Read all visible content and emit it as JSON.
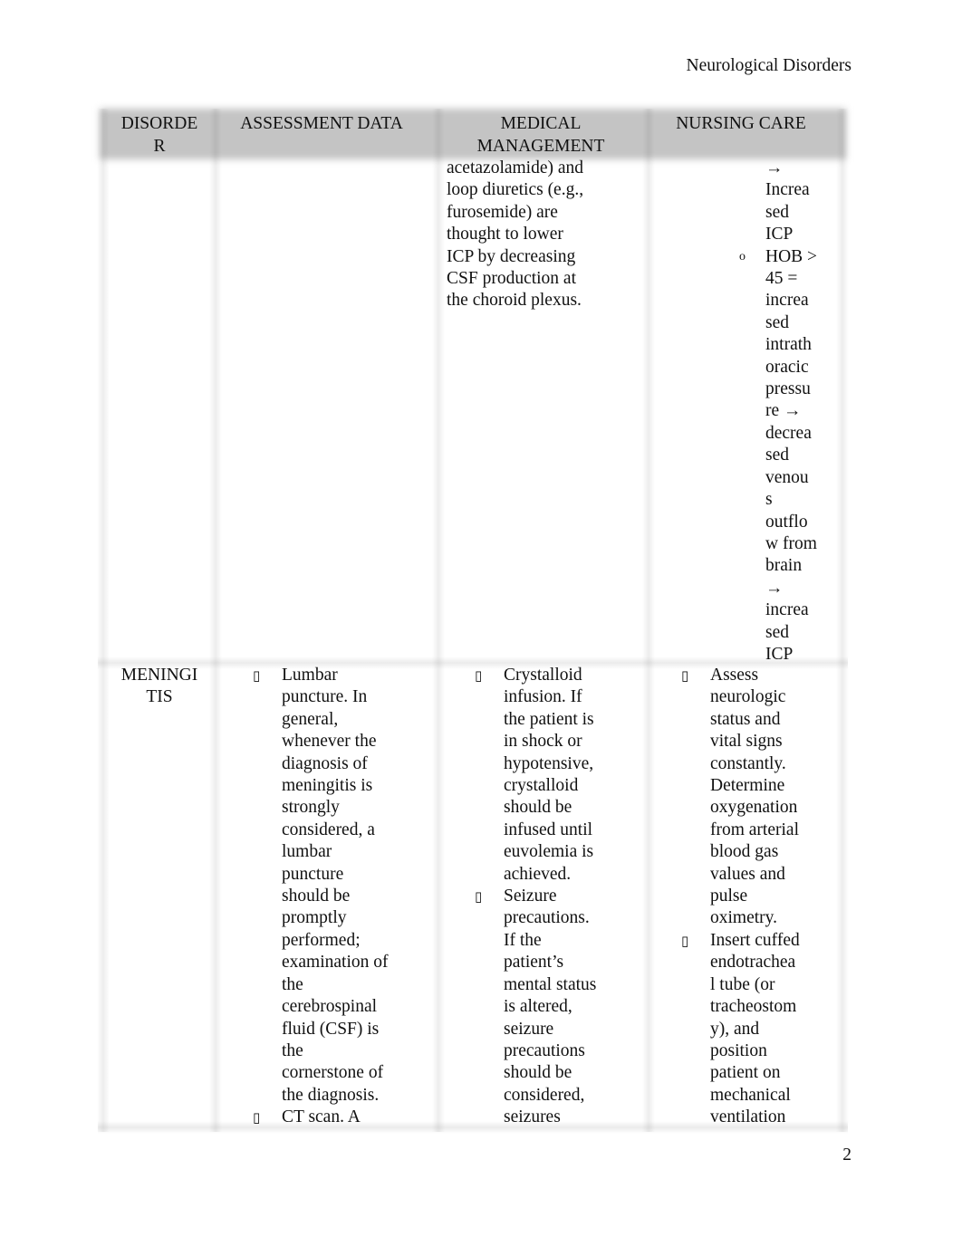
{
  "page": {
    "running_header": "Neurological Disorders",
    "page_number": "2"
  },
  "table": {
    "headers": [
      "DISORDE\nR",
      "ASSESSMENT DATA",
      "MEDICAL\nMANAGEMENT",
      "NURSING CARE"
    ],
    "continued_row": {
      "disorder": "",
      "assessment": "",
      "medical_lines": [
        "acetazolamide) and",
        "loop diuretics (e.g.,",
        "furosemide) are",
        "thought to lower",
        "ICP by decreasing",
        "CSF production at",
        "the choroid plexus."
      ],
      "nursing_lines_top": [
        "→",
        "Increa",
        "sed",
        "ICP"
      ],
      "nursing_sub_bullet": "o",
      "nursing_lines_sub": [
        "HOB >",
        "45 =",
        "increa",
        "sed",
        "intrath",
        "oracic",
        "pressu",
        "re →",
        "decrea",
        "sed",
        "venou",
        "s",
        "outflo",
        "w from",
        "brain",
        "→",
        "increa",
        "sed",
        "ICP"
      ]
    },
    "meningitis_row": {
      "disorder_lines": [
        "MENINGI",
        "TIS"
      ],
      "bullet_glyph": "",
      "assessment_items": [
        {
          "lines": [
            "Lumbar",
            "puncture. In",
            "general,",
            "whenever the",
            "diagnosis of",
            "meningitis is",
            "strongly",
            "considered, a",
            "lumbar",
            "puncture",
            "should be",
            "promptly",
            "performed;",
            "examination of",
            "the",
            "cerebrospinal",
            "fluid (CSF) is",
            "the",
            "cornerstone of",
            "the diagnosis."
          ]
        },
        {
          "lines": [
            "CT scan. A"
          ]
        }
      ],
      "medical_items": [
        {
          "lines": [
            "Crystalloid",
            "infusion. If",
            "the patient is",
            "in shock or",
            "hypotensive,",
            "crystalloid",
            "should be",
            "infused until",
            "euvolemia is",
            "achieved."
          ]
        },
        {
          "lines": [
            "Seizure",
            "precautions.",
            "If the",
            "patient’s",
            "mental status",
            "is altered,",
            "seizure",
            "precautions",
            "should be",
            "considered,",
            "seizures"
          ]
        }
      ],
      "nursing_items": [
        {
          "lines": [
            "Assess",
            "neurologic",
            "status and",
            "vital signs",
            "constantly.",
            "Determine",
            "oxygenation",
            "from arterial",
            "blood gas",
            "values and",
            "pulse",
            "oximetry."
          ]
        },
        {
          "lines": [
            "Insert cuffed",
            "endotrachea",
            "l tube (or",
            "tracheostom",
            "y), and",
            "position",
            "patient on",
            "mechanical",
            "ventilation"
          ]
        }
      ]
    }
  }
}
